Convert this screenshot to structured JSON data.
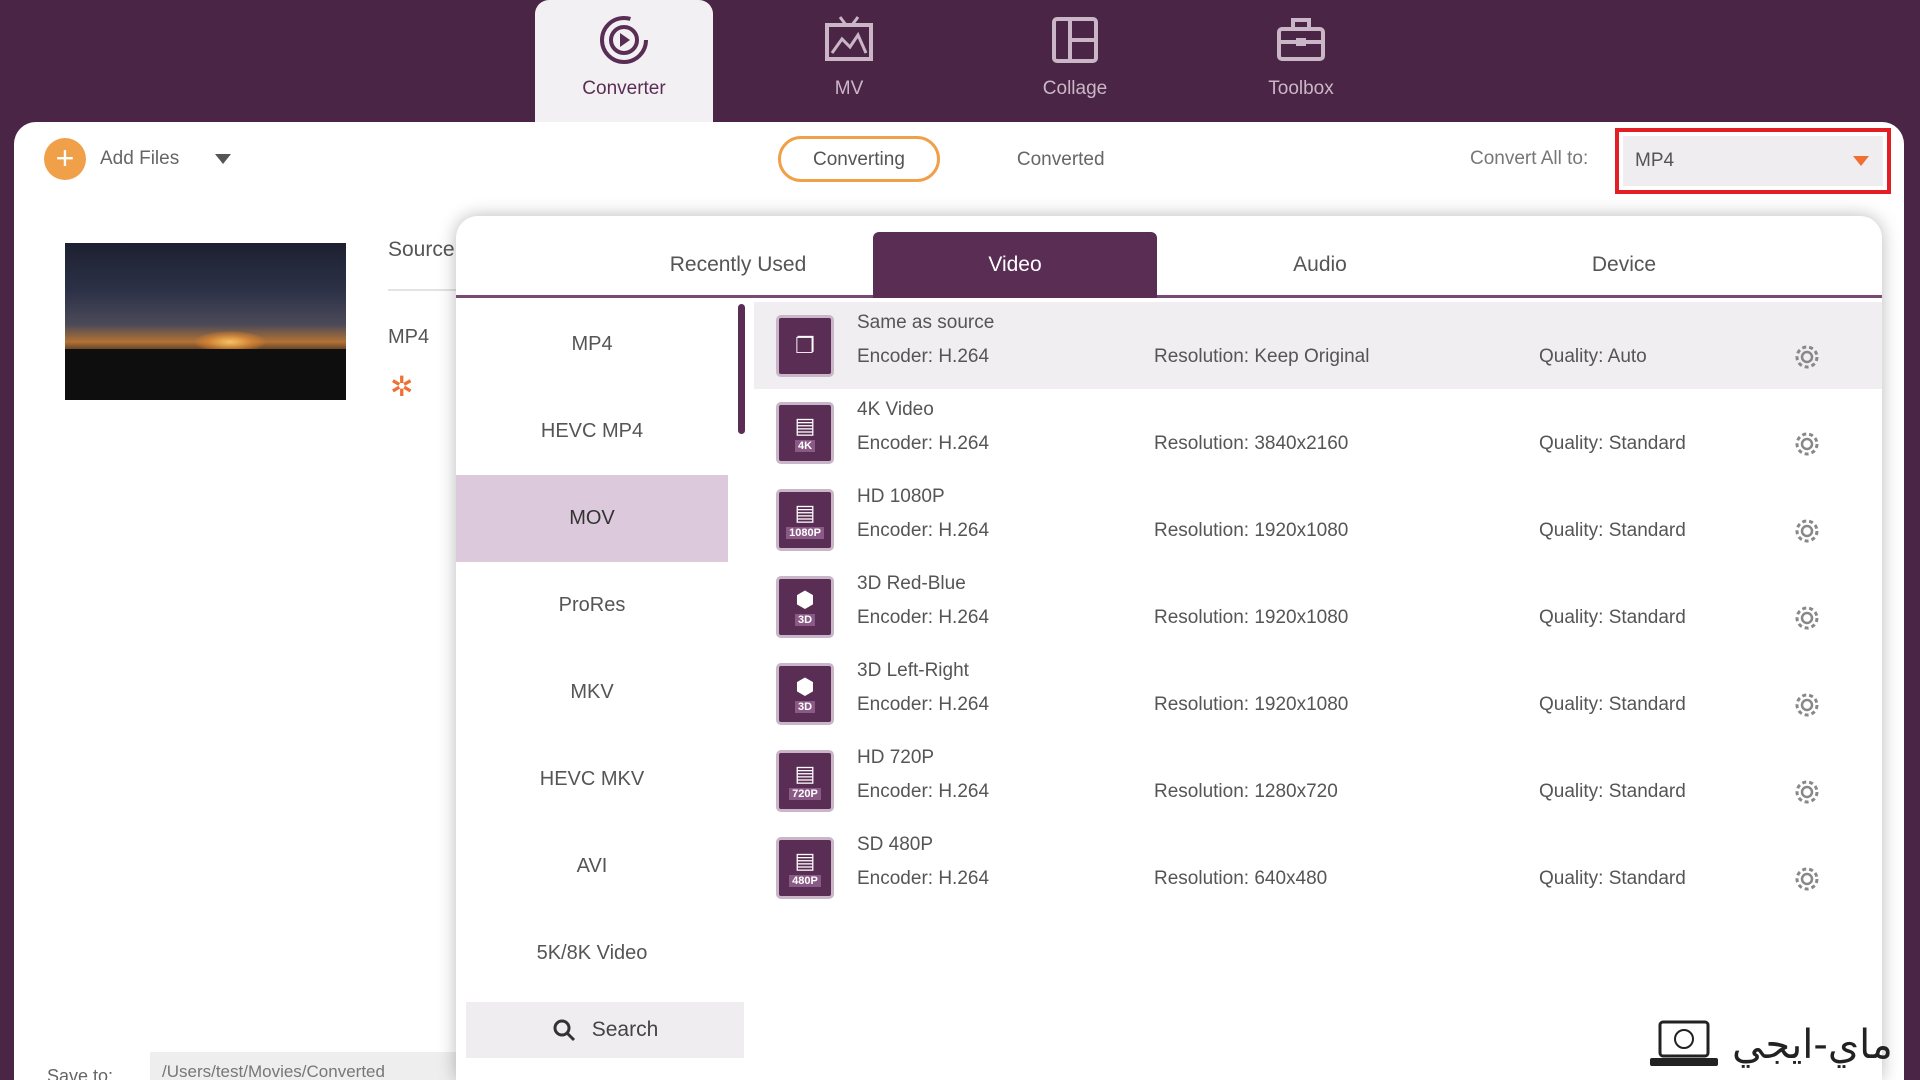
{
  "nav": {
    "tabs": [
      {
        "label": "Converter",
        "icon": "converter-icon",
        "active": true
      },
      {
        "label": "MV",
        "icon": "mv-icon",
        "active": false
      },
      {
        "label": "Collage",
        "icon": "collage-icon",
        "active": false
      },
      {
        "label": "Toolbox",
        "icon": "toolbox-icon",
        "active": false
      }
    ]
  },
  "toolbar": {
    "add_files": "Add Files",
    "converting": "Converting",
    "converted": "Converted",
    "convert_all_label": "Convert All to:",
    "convert_all_value": "MP4"
  },
  "file": {
    "source_label": "Source",
    "format": "MP4"
  },
  "save_to": {
    "label": "Save to:",
    "path": "/Users/test/Movies/Converted"
  },
  "popup": {
    "tabs": [
      "Recently Used",
      "Video",
      "Audio",
      "Device"
    ],
    "active_tab": "Video",
    "categories": [
      "MP4",
      "HEVC MP4",
      "MOV",
      "ProRes",
      "MKV",
      "HEVC MKV",
      "AVI",
      "5K/8K Video"
    ],
    "active_category": "MOV",
    "search": "Search",
    "formats": [
      {
        "name": "Same as source",
        "encoder": "Encoder: H.264",
        "resolution": "Resolution: Keep Original",
        "quality": "Quality: Auto",
        "tag": ""
      },
      {
        "name": "4K Video",
        "encoder": "Encoder: H.264",
        "resolution": "Resolution: 3840x2160",
        "quality": "Quality: Standard",
        "tag": "4K"
      },
      {
        "name": "HD 1080P",
        "encoder": "Encoder: H.264",
        "resolution": "Resolution: 1920x1080",
        "quality": "Quality: Standard",
        "tag": "1080P"
      },
      {
        "name": "3D Red-Blue",
        "encoder": "Encoder: H.264",
        "resolution": "Resolution: 1920x1080",
        "quality": "Quality: Standard",
        "tag": "3D"
      },
      {
        "name": "3D Left-Right",
        "encoder": "Encoder: H.264",
        "resolution": "Resolution: 1920x1080",
        "quality": "Quality: Standard",
        "tag": "3D"
      },
      {
        "name": "HD 720P",
        "encoder": "Encoder: H.264",
        "resolution": "Resolution: 1280x720",
        "quality": "Quality: Standard",
        "tag": "720P"
      },
      {
        "name": "SD 480P",
        "encoder": "Encoder: H.264",
        "resolution": "Resolution: 640x480",
        "quality": "Quality: Standard",
        "tag": "480P"
      }
    ]
  },
  "watermark": {
    "text": "ماي-ايجي"
  },
  "colors": {
    "brand_purple": "#5a2d55",
    "background": "#4a2545",
    "accent_orange": "#f0a049",
    "highlight_red": "#e31e24"
  }
}
